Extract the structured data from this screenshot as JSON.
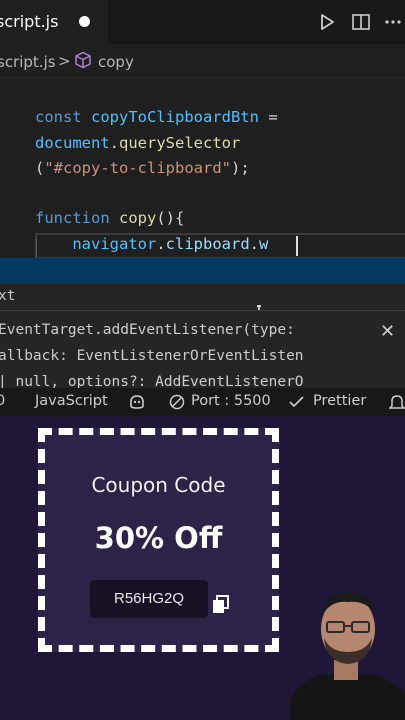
{
  "editor": {
    "tab": {
      "filename": "script.js",
      "dirty": true
    },
    "breadcrumb": {
      "file": "script.js",
      "separator": ">",
      "symbol": "copy"
    },
    "code_lines": [
      {
        "tokens": [
          [
            "kw",
            "const "
          ],
          [
            "var",
            "copyToClipboardBtn"
          ],
          [
            "pl",
            " ="
          ]
        ]
      },
      {
        "tokens": [
          [
            "var",
            "document"
          ],
          [
            "pl",
            "."
          ],
          [
            "fn",
            "querySelector"
          ]
        ]
      },
      {
        "tokens": [
          [
            "pl",
            "("
          ],
          [
            "str",
            "\"#copy-to-clipboard\""
          ],
          [
            "pl",
            ");"
          ]
        ]
      },
      {
        "tokens": []
      },
      {
        "tokens": [
          [
            "kw",
            "function "
          ],
          [
            "fn",
            "copy"
          ],
          [
            "pl",
            "(){"
          ]
        ]
      },
      {
        "tokens": [
          [
            "pl",
            "    "
          ],
          [
            "var",
            "navigator"
          ],
          [
            "pl",
            "."
          ],
          [
            "prop",
            "clipboard"
          ],
          [
            "pl",
            "."
          ],
          [
            "prop",
            "w"
          ]
        ]
      }
    ]
  },
  "suggestions": {
    "item_label": "xt",
    "detail": {
      "lines": [
        "EventTarget.addEventListener(type:",
        "allback: EventListenerOrEventListen",
        "| null, options?: AddEventListenerO"
      ],
      "close_glyph": "✕"
    }
  },
  "statusbar": {
    "left_glyph": "0",
    "language": "JavaScript",
    "port": "Port : 5500",
    "prettier": "Prettier"
  },
  "preview": {
    "coupon_title": "Coupon Code",
    "discount": "30% Off",
    "code": "R56HG2Q"
  },
  "colors": {
    "editor_bg": "#1f1f1f",
    "selection": "#04395e",
    "preview_bg": "#201638",
    "coupon_bg": "#2d2348",
    "code_box_bg": "#171123"
  }
}
